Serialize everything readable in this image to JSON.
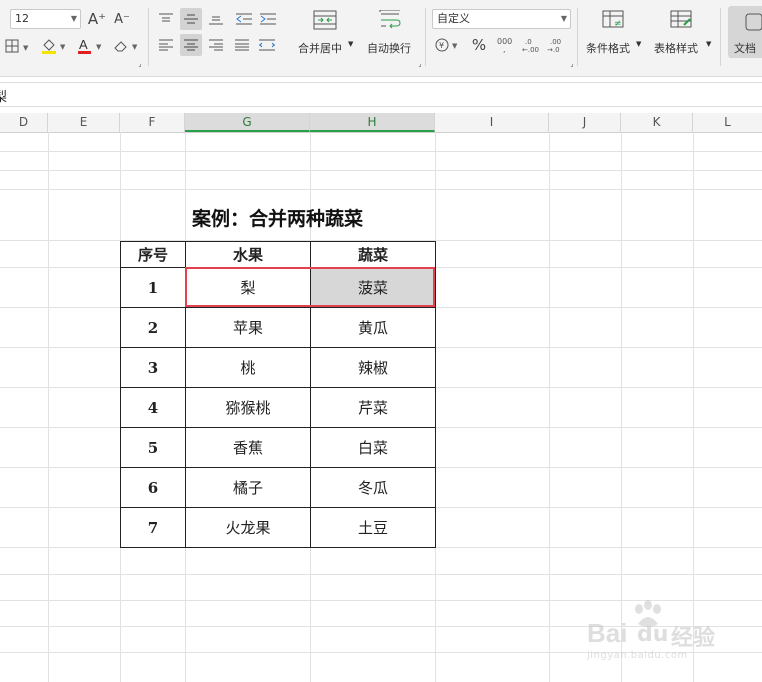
{
  "toolbar": {
    "font_size": "12",
    "number_format": "自定义",
    "merge_center_label": "合并居中",
    "wrap_text_label": "自动换行",
    "conditional_format_label": "条件格式",
    "table_style_label": "表格样式",
    "doc_label": "文档",
    "increase_font": "A⁺",
    "decrease_font": "A⁻",
    "percent": "%",
    "currency": "¥"
  },
  "formula_bar": {
    "content": "梨"
  },
  "columns": [
    "D",
    "E",
    "F",
    "G",
    "H",
    "I",
    "J",
    "K",
    "L"
  ],
  "sheet": {
    "title": "案例：合并两种蔬菜",
    "headers": [
      "序号",
      "水果",
      "蔬菜"
    ],
    "rows": [
      {
        "n": "1",
        "fruit": "梨",
        "veg": "菠菜"
      },
      {
        "n": "2",
        "fruit": "苹果",
        "veg": "黄瓜"
      },
      {
        "n": "3",
        "fruit": "桃",
        "veg": "辣椒"
      },
      {
        "n": "4",
        "fruit": "猕猴桃",
        "veg": "芹菜"
      },
      {
        "n": "5",
        "fruit": "香蕉",
        "veg": "白菜"
      },
      {
        "n": "6",
        "fruit": "橘子",
        "veg": "冬瓜"
      },
      {
        "n": "7",
        "fruit": "火龙果",
        "veg": "土豆"
      }
    ]
  },
  "watermark": {
    "brand": "Bai",
    "sub": "jingyan.baidu.com",
    "cn": "经验"
  },
  "colors": {
    "selection_border": "#e0434d",
    "active_header": "#2a9d4a"
  }
}
